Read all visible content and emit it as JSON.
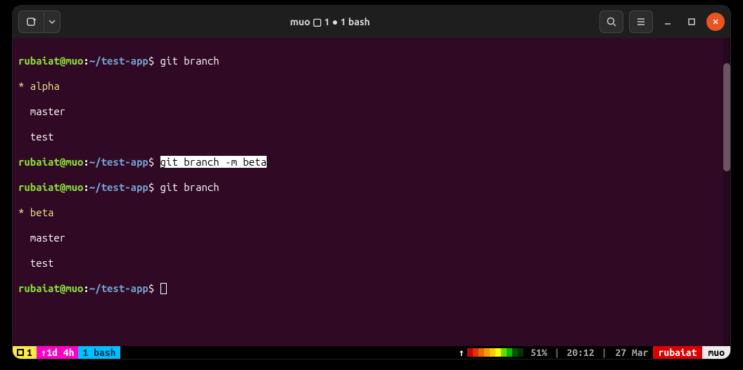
{
  "titlebar": {
    "title": "muo ▢ 1 ● 1 bash"
  },
  "prompt": {
    "user": "rubaiat",
    "at": "@",
    "host": "muo",
    "colon": ":",
    "path": "~/test-app",
    "dollar": "$"
  },
  "lines": {
    "cmd1": "git branch",
    "out1_star": "*",
    "out1_current": " alpha",
    "out1_master": "  master",
    "out1_test": "  test",
    "cmd2_hl": "git branch -m beta",
    "cmd3": "git branch",
    "out2_star": "*",
    "out2_current": " beta",
    "out2_master": "  master",
    "out2_test": "  test"
  },
  "status": {
    "session": "1",
    "uptime_arrow": "↑",
    "uptime": " 1d 4h",
    "tab": " 1 bash",
    "batt_arrow": "↑",
    "batt_colors": [
      "#cc0000",
      "#dd3300",
      "#ee6600",
      "#ff9900",
      "#ffcc00",
      "#ffff00",
      "#66dd00",
      "#00c000",
      "#005500",
      "#003300"
    ],
    "batt_pct": "51%",
    "sep": "|",
    "time": "20:12",
    "date": "27 Mar",
    "user": "rubaiat",
    "host": "muo"
  }
}
